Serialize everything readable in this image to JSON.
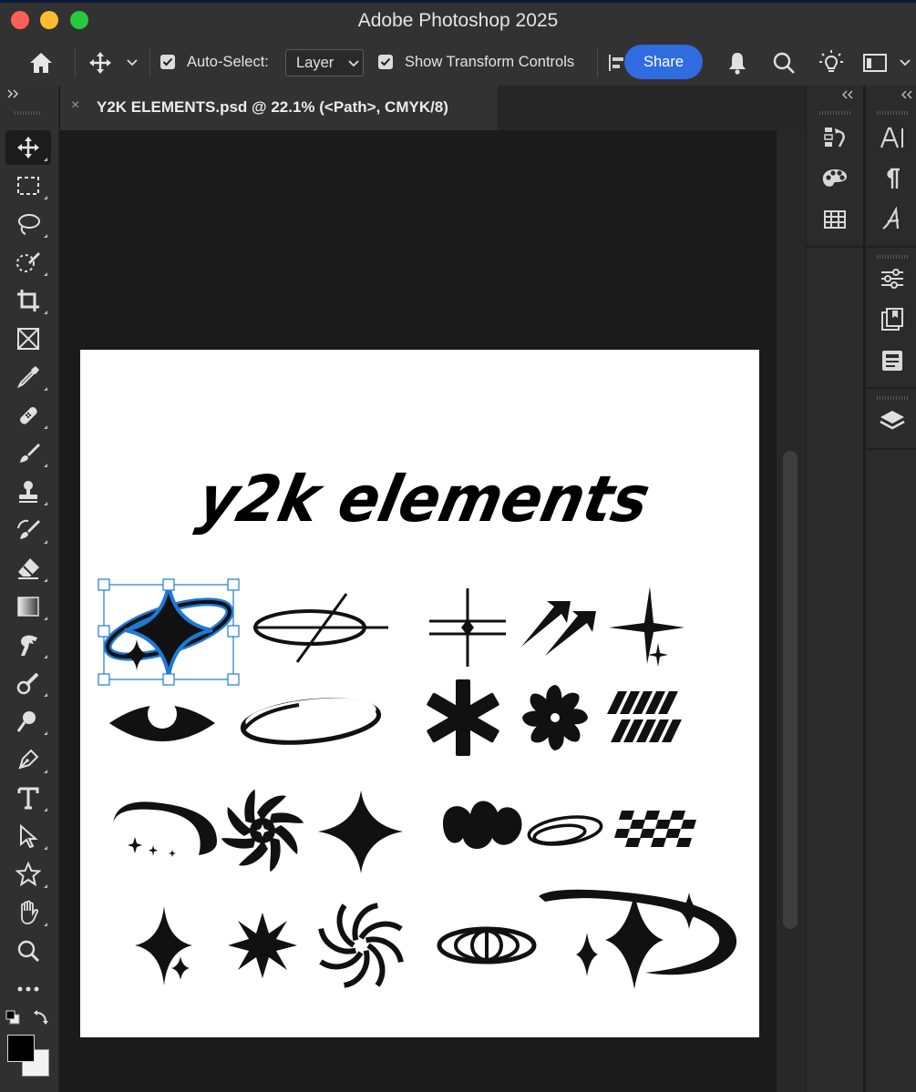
{
  "window": {
    "title": "Adobe Photoshop 2025"
  },
  "options_bar": {
    "auto_select_label": "Auto-Select:",
    "auto_select_target": "Layer",
    "show_transform_controls_label": "Show Transform Controls",
    "share_label": "Share"
  },
  "document_tab": {
    "title": "Y2K ELEMENTS.psd @ 22.1% (<Path>, CMYK/8)",
    "close_glyph": "×"
  },
  "artwork": {
    "heading": "y2k elements"
  },
  "tools": [
    "move-tool",
    "rectangular-marquee-tool",
    "lasso-tool",
    "object-selection-tool",
    "crop-tool",
    "frame-tool",
    "eyedropper-tool",
    "spot-healing-brush-tool",
    "brush-tool",
    "clone-stamp-tool",
    "history-brush-tool",
    "eraser-tool",
    "gradient-tool",
    "smudge-tool",
    "dodge-tool",
    "burn-tool",
    "pen-tool",
    "type-tool",
    "path-selection-tool",
    "custom-shape-tool",
    "hand-tool",
    "zoom-tool",
    "more-tools"
  ],
  "colors": {
    "foreground": "#000000",
    "background": "#ffffff",
    "accent": "#2f6ce0",
    "selection": "#1e7ad6"
  }
}
